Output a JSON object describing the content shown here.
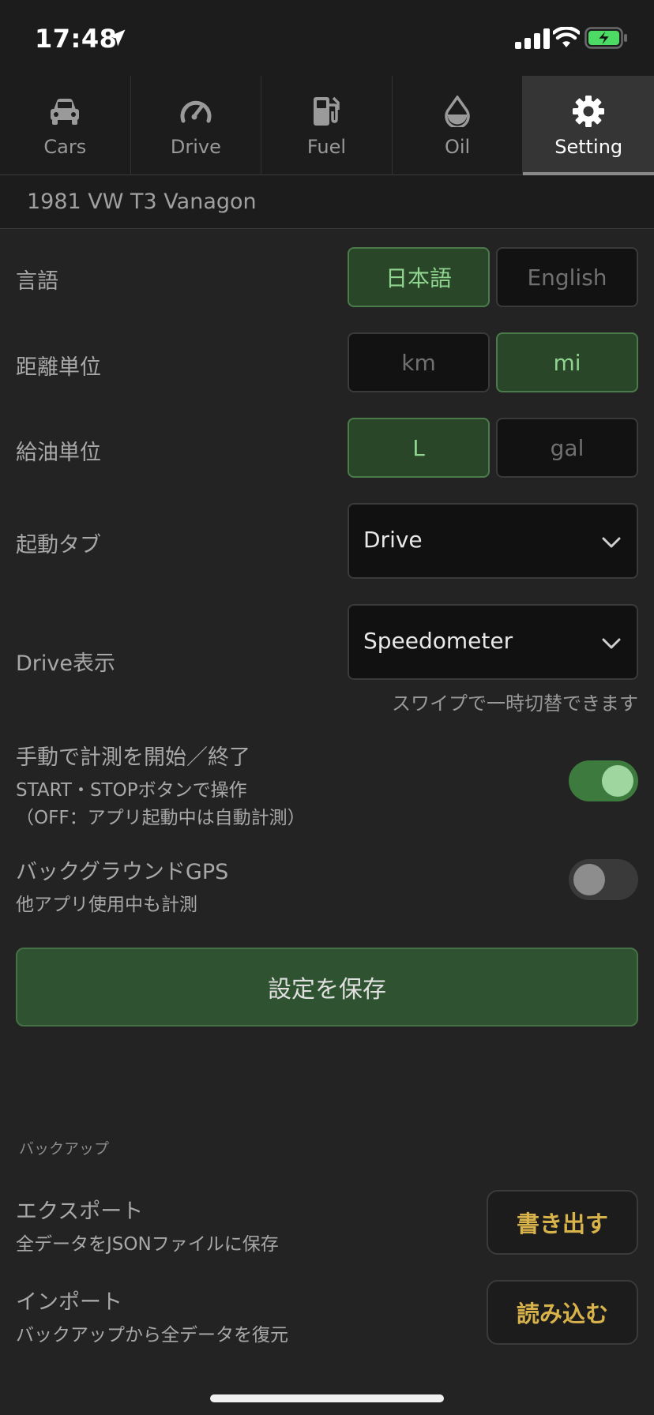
{
  "status": {
    "time": "17:48"
  },
  "tabs": [
    {
      "label": "Cars",
      "icon": "car-icon"
    },
    {
      "label": "Drive",
      "icon": "speedometer-icon"
    },
    {
      "label": "Fuel",
      "icon": "fuel-pump-icon"
    },
    {
      "label": "Oil",
      "icon": "oil-drop-icon"
    },
    {
      "label": "Setting",
      "icon": "gear-icon",
      "active": true
    }
  ],
  "car": {
    "name": "1981 VW T3 Vanagon"
  },
  "settings": {
    "language": {
      "label": "言語",
      "options": [
        "日本語",
        "English"
      ],
      "selected": "日本語"
    },
    "distance_unit": {
      "label": "距離単位",
      "options": [
        "km",
        "mi"
      ],
      "selected": "mi"
    },
    "fuel_unit": {
      "label": "給油単位",
      "options": [
        "L",
        "gal"
      ],
      "selected": "L"
    },
    "start_tab": {
      "label": "起動タブ",
      "value": "Drive"
    },
    "drive_display": {
      "label": "Drive表示",
      "value": "Speedometer",
      "hint": "スワイプで一時切替できます"
    },
    "manual_measure": {
      "label": "手動で計測を開始／終了",
      "sub1": "START・STOPボタンで操作",
      "sub2": "（OFF：アプリ起動中は自動計測）",
      "on": true
    },
    "background_gps": {
      "label": "バックグラウンドGPS",
      "sub": "他アプリ使用中も計測",
      "on": false
    },
    "save_label": "設定を保存"
  },
  "backup": {
    "section_label": "バックアップ",
    "export": {
      "title": "エクスポート",
      "sub": "全データをJSONファイルに保存",
      "button": "書き出す"
    },
    "import": {
      "title": "インポート",
      "sub": "バックアップから全データを復元",
      "button": "読み込む"
    }
  },
  "colors": {
    "accent_green": "#8fd48f",
    "save_bg": "#2f5330",
    "action_gold": "#d8b24a"
  }
}
